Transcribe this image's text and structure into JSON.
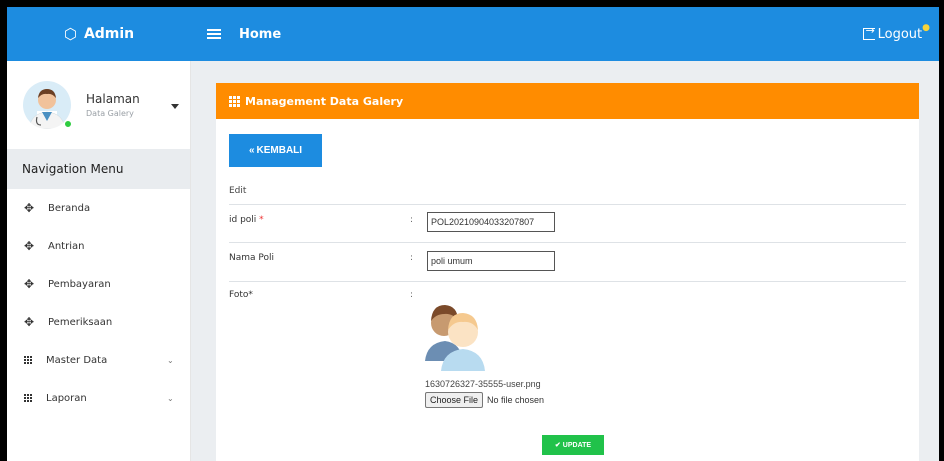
{
  "topbar": {
    "brand": "Admin",
    "home": "Home",
    "logout": "Logout"
  },
  "sidebar": {
    "profile_title": "Halaman",
    "profile_subtitle": "Data Galery",
    "nav_header": "Navigation Menu",
    "items": [
      {
        "label": "Beranda",
        "icon": "move-arrows-icon"
      },
      {
        "label": "Antrian",
        "icon": "move-arrows-icon"
      },
      {
        "label": "Pembayaran",
        "icon": "move-arrows-icon"
      },
      {
        "label": "Pemeriksaan",
        "icon": "move-arrows-icon"
      },
      {
        "label": "Master Data",
        "icon": "grid-icon",
        "expandable": true
      },
      {
        "label": "Laporan",
        "icon": "grid-icon",
        "expandable": true
      }
    ]
  },
  "card": {
    "title": "Management Data Galery",
    "back_button": "KEMBALI",
    "section": "Edit",
    "fields": {
      "id_poli_label": "id poli",
      "id_poli_required": "*",
      "id_poli_value": "POL20210904033207807",
      "nama_poli_label": "Nama Poli",
      "nama_poli_value": "poli umum",
      "foto_label": "Foto*",
      "colon": ":"
    },
    "file_name": "1630726327-35555-user.png",
    "choose_file": "Choose File",
    "no_file": "No file chosen",
    "update_button": "UPDATE"
  },
  "colors": {
    "primary": "#1d8ce0",
    "header_orange": "#ff8c00",
    "success": "#21c24a"
  }
}
